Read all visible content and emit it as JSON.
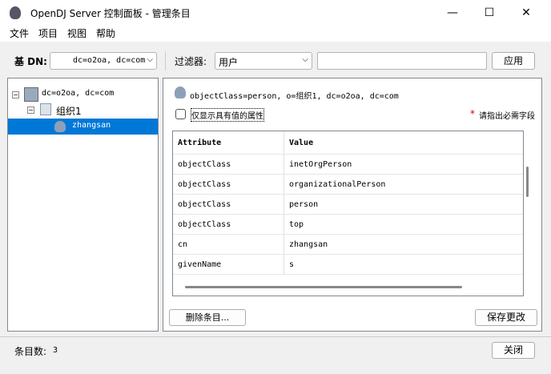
{
  "window": {
    "title": "OpenDJ Server 控制面板 - 管理条目",
    "minimize": "—",
    "maximize": "☐",
    "close": "✕"
  },
  "menu": [
    "文件",
    "项目",
    "视图",
    "帮助"
  ],
  "toolbar": {
    "base_dn_label": "基 DN:",
    "base_dn_value": "dc=o2oa, dc=com",
    "filter_label": "过滤器:",
    "filter_value": "用户",
    "filter_text": "",
    "apply": "应用"
  },
  "tree": {
    "root": "dc=o2oa, dc=com",
    "org": "组织1",
    "user": "zhangsan"
  },
  "entry": {
    "dn": "objectClass=person, o=组织1, dc=o2oa, dc=com",
    "checkbox_label": "仅显示具有值的属性",
    "required_note": "请指出必需字段",
    "required_star": "*"
  },
  "table": {
    "headers": [
      "Attribute",
      "Value"
    ],
    "rows": [
      [
        "objectClass",
        "inetOrgPerson"
      ],
      [
        "objectClass",
        "organizationalPerson"
      ],
      [
        "objectClass",
        "person"
      ],
      [
        "objectClass",
        "top"
      ],
      [
        "cn",
        "zhangsan"
      ],
      [
        "givenName",
        "s"
      ]
    ]
  },
  "buttons": {
    "delete": "删除条目...",
    "save": "保存更改",
    "close": "关闭"
  },
  "status": {
    "label": "条目数:",
    "count": "3"
  }
}
